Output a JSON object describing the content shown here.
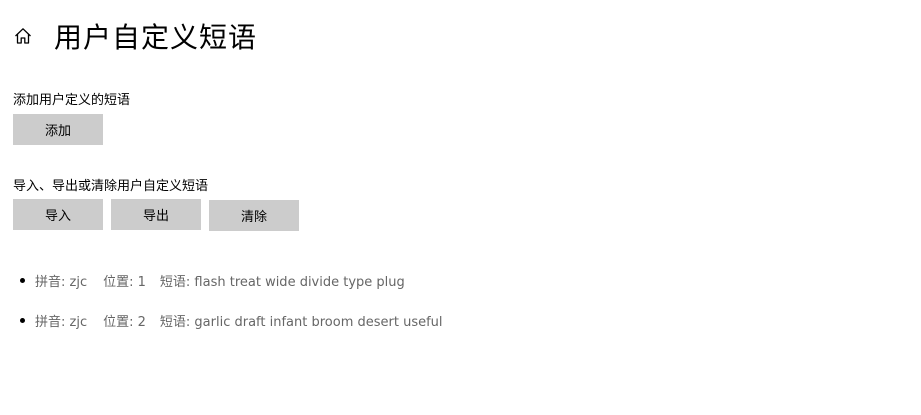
{
  "header": {
    "title": "用户自定义短语",
    "home_icon": "home-icon"
  },
  "add_section": {
    "label": "添加用户定义的短语",
    "add_button": "添加"
  },
  "manage_section": {
    "label": "导入、导出或清除用户自定义短语",
    "import_button": "导入",
    "export_button": "导出",
    "clear_button": "清除"
  },
  "phrases": [
    {
      "pinyin": "拼音: zjc",
      "position": "位置: 1",
      "phrase": "短语: flash treat wide divide type plug"
    },
    {
      "pinyin": "拼音: zjc",
      "position": "位置: 2",
      "phrase": "短语: garlic draft infant broom desert useful"
    }
  ],
  "colors": {
    "button_bg": "#cccccc",
    "list_text": "#666666"
  }
}
